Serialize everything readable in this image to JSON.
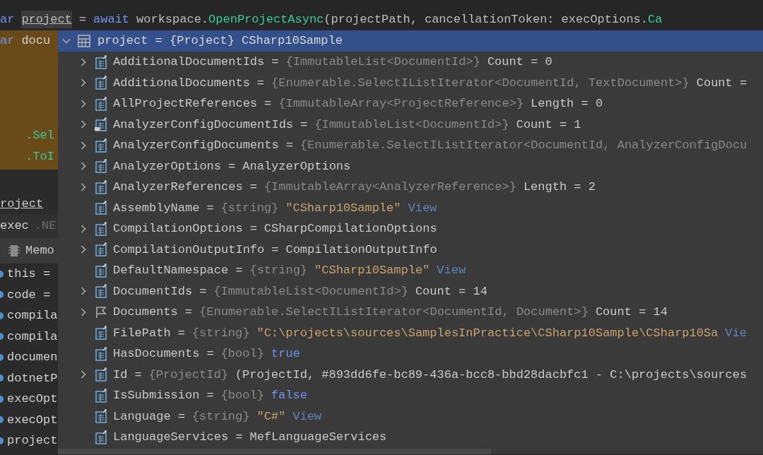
{
  "code_line": [
    {
      "tokens": [
        {
          "kind": "keyword",
          "text": "ar"
        }
      ]
    },
    {
      "tokens": [
        {
          "kind": "var",
          "text": "project"
        }
      ]
    },
    {
      "tokens": [
        {
          "kind": "plain",
          "text": "="
        }
      ]
    },
    {
      "tokens": [
        {
          "kind": "keyword",
          "text": "await"
        }
      ]
    },
    {
      "tokens": [
        {
          "kind": "plain",
          "text": "workspace."
        },
        {
          "kind": "method",
          "text": "OpenProjectAsync"
        },
        {
          "kind": "plain",
          "text": "(projectPath,"
        }
      ]
    },
    {
      "tokens": [
        {
          "kind": "plain",
          "text": "cancellationToken:"
        }
      ]
    },
    {
      "tokens": [
        {
          "kind": "plain",
          "text": "execOptions."
        },
        {
          "kind": "method",
          "text": "Ca"
        }
      ]
    }
  ],
  "editor_lines": [
    {
      "kind": "keyword_var",
      "keyword": "ar",
      "text": "docu"
    },
    {
      "kind": "call",
      "text": ".Sel"
    },
    {
      "kind": "call",
      "text": ".ToI"
    }
  ],
  "watch_header": {
    "text": "roject"
  },
  "exec_row": {
    "name": "exec",
    "suffix": ".NE"
  },
  "debug_tab": {
    "label": "Memo"
  },
  "variables": [
    "this =",
    "code =",
    "compila",
    "compila",
    "documen",
    "dotnetP",
    "execOpt",
    "execOpt",
    "project"
  ],
  "popup": {
    "header": {
      "text": "project = {Project} CSharp10Sample",
      "expanded": true,
      "selected": true
    },
    "rows": [
      {
        "expandable": true,
        "kind": "field",
        "name": "AdditionalDocumentIds",
        "operator": "=",
        "segments": [
          {
            "kind": "type",
            "text": "{ImmutableList<DocumentId>}"
          },
          {
            "kind": "plain",
            "text": "Count = 0"
          }
        ]
      },
      {
        "expandable": true,
        "kind": "field",
        "name": "AdditionalDocuments",
        "operator": "=",
        "segments": [
          {
            "kind": "type",
            "text": "{Enumerable.SelectIListIterator<DocumentId, TextDocument>}"
          },
          {
            "kind": "plain",
            "text": "Count ="
          }
        ]
      },
      {
        "expandable": true,
        "kind": "field",
        "name": "AllProjectReferences",
        "operator": "=",
        "segments": [
          {
            "kind": "type",
            "text": "{ImmutableArray<ProjectReference>}"
          },
          {
            "kind": "plain",
            "text": "Length = 0"
          }
        ]
      },
      {
        "expandable": true,
        "kind": "field_badge",
        "name": "AnalyzerConfigDocumentIds",
        "operator": "=",
        "segments": [
          {
            "kind": "type",
            "text": "{ImmutableList<DocumentId>}"
          },
          {
            "kind": "plain",
            "text": "Count = 1"
          }
        ]
      },
      {
        "expandable": true,
        "kind": "field",
        "name": "AnalyzerConfigDocuments",
        "operator": "=",
        "segments": [
          {
            "kind": "type",
            "text": "{Enumerable.SelectIListIterator<DocumentId, AnalyzerConfigDocu"
          }
        ]
      },
      {
        "expandable": true,
        "kind": "field",
        "name": "AnalyzerOptions",
        "operator": "=",
        "segments": [
          {
            "kind": "plain",
            "text": "AnalyzerOptions"
          }
        ]
      },
      {
        "expandable": true,
        "kind": "field",
        "name": "AnalyzerReferences",
        "operator": "=",
        "segments": [
          {
            "kind": "type",
            "text": "{ImmutableArray<AnalyzerReference>}"
          },
          {
            "kind": "plain",
            "text": "Length = 2"
          }
        ]
      },
      {
        "expandable": false,
        "kind": "field",
        "name": "AssemblyName",
        "operator": "=",
        "segments": [
          {
            "kind": "type",
            "text": "{string}"
          },
          {
            "kind": "string",
            "text": "\"CSharp10Sample\""
          },
          {
            "kind": "link",
            "text": "View"
          }
        ]
      },
      {
        "expandable": true,
        "kind": "field",
        "name": "CompilationOptions",
        "operator": "=",
        "segments": [
          {
            "kind": "plain",
            "text": "CSharpCompilationOptions"
          }
        ]
      },
      {
        "expandable": true,
        "kind": "field",
        "name": "CompilationOutputInfo",
        "operator": "=",
        "segments": [
          {
            "kind": "plain",
            "text": "CompilationOutputInfo"
          }
        ]
      },
      {
        "expandable": false,
        "kind": "field",
        "name": "DefaultNamespace",
        "operator": "=",
        "segments": [
          {
            "kind": "type",
            "text": "{string}"
          },
          {
            "kind": "string",
            "text": "\"CSharp10Sample\""
          },
          {
            "kind": "link",
            "text": "View"
          }
        ]
      },
      {
        "expandable": true,
        "kind": "field",
        "name": "DocumentIds",
        "operator": "=",
        "segments": [
          {
            "kind": "type",
            "text": "{ImmutableList<DocumentId>}"
          },
          {
            "kind": "plain",
            "text": "Count = 14"
          }
        ]
      },
      {
        "expandable": true,
        "kind": "flag",
        "name": "Documents",
        "operator": "=",
        "segments": [
          {
            "kind": "type",
            "text": "{Enumerable.SelectIListIterator<DocumentId, Document>}"
          },
          {
            "kind": "plain",
            "text": "Count = 14"
          }
        ]
      },
      {
        "expandable": false,
        "kind": "field",
        "name": "FilePath",
        "operator": "=",
        "segments": [
          {
            "kind": "type",
            "text": "{string}"
          },
          {
            "kind": "string",
            "text": "\"C:\\projects\\sources\\SamplesInPractice\\CSharp10Sample\\CSharp10Sa"
          },
          {
            "kind": "link",
            "text": "Vie"
          }
        ]
      },
      {
        "expandable": false,
        "kind": "field",
        "name": "HasDocuments",
        "operator": "=",
        "segments": [
          {
            "kind": "type",
            "text": "{bool}"
          },
          {
            "kind": "bool",
            "text": "true"
          }
        ]
      },
      {
        "expandable": true,
        "kind": "field",
        "name": "Id",
        "operator": "=",
        "segments": [
          {
            "kind": "type",
            "text": "{ProjectId}"
          },
          {
            "kind": "plain",
            "text": "(ProjectId, #893dd6fe-bc89-436a-bcc8-bbd28dacbfc1 - C:\\projects\\sources"
          }
        ]
      },
      {
        "expandable": false,
        "kind": "field",
        "name": "IsSubmission",
        "operator": "=",
        "segments": [
          {
            "kind": "type",
            "text": "{bool}"
          },
          {
            "kind": "bool",
            "text": "false"
          }
        ]
      },
      {
        "expandable": false,
        "kind": "field",
        "name": "Language",
        "operator": "=",
        "segments": [
          {
            "kind": "type",
            "text": "{string}"
          },
          {
            "kind": "string",
            "text": "\"C#\""
          },
          {
            "kind": "link",
            "text": "View"
          }
        ]
      },
      {
        "expandable": false,
        "kind": "field",
        "name": "LanguageServices",
        "operator": "=",
        "segments": [
          {
            "kind": "plain",
            "text": "MefLanguageServices"
          }
        ]
      }
    ]
  }
}
